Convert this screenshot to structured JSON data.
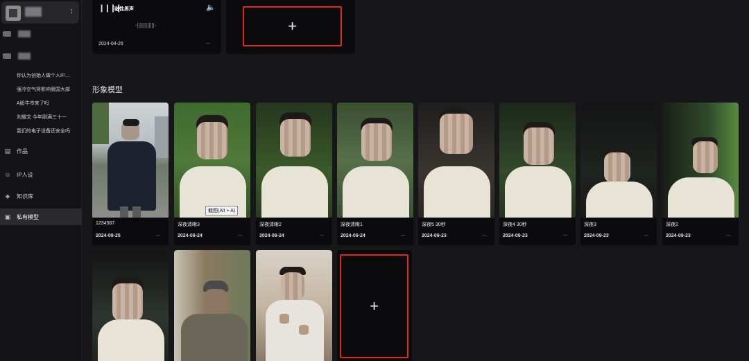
{
  "sidebar": {
    "account_switch_icon": "↕",
    "topics": [
      "你认为创始人做个人IP…",
      "强冷空气将影响我国大部",
      "A股牛市来了吗",
      "刘耀文 今年刚满三十一",
      "我们的电子设备还安全吗"
    ],
    "nav": [
      {
        "icon": "▤",
        "label": "作品",
        "icon_name": "works-icon"
      },
      {
        "icon": "☺",
        "label": "IP人设",
        "icon_name": "ip-persona-icon"
      },
      {
        "icon": "◈",
        "label": "知识库",
        "icon_name": "knowledge-base-icon"
      },
      {
        "icon": "▣",
        "label": "私有模型",
        "icon_name": "private-model-icon"
      }
    ]
  },
  "voice_card": {
    "name": "磁性男声",
    "date": "2024-04-26",
    "more": "...",
    "wave_icon": "❙❙❙❙",
    "speaker_icon": "🔈",
    "waveform": "-||||||||||||-"
  },
  "add_button": {
    "symbol": "+"
  },
  "section_title": "形象模型",
  "models": [
    {
      "label": "1234567",
      "date": "2024-09-25",
      "more": "..."
    },
    {
      "label": "深夜清晰3",
      "date": "2024-09-24",
      "more": "..."
    },
    {
      "label": "深夜清晰2",
      "date": "2024-09-24",
      "more": "..."
    },
    {
      "label": "深夜清晰1",
      "date": "2024-09-24",
      "more": "..."
    },
    {
      "label": "深夜5 30秒",
      "date": "2024-09-23",
      "more": "..."
    },
    {
      "label": "深夜4 30秒",
      "date": "2024-09-23",
      "more": "..."
    },
    {
      "label": "深夜3",
      "date": "2024-09-23",
      "more": "..."
    },
    {
      "label": "深夜2",
      "date": "2024-09-23",
      "more": "..."
    },
    {
      "label": "",
      "date": "",
      "more": ""
    },
    {
      "label": "",
      "date": "",
      "more": ""
    },
    {
      "label": "",
      "date": "",
      "more": ""
    }
  ],
  "tooltip": "截图(Alt + A)",
  "colors": {
    "accent_red": "#e0271f",
    "background": "#17171a",
    "card": "#0b0b0d"
  }
}
